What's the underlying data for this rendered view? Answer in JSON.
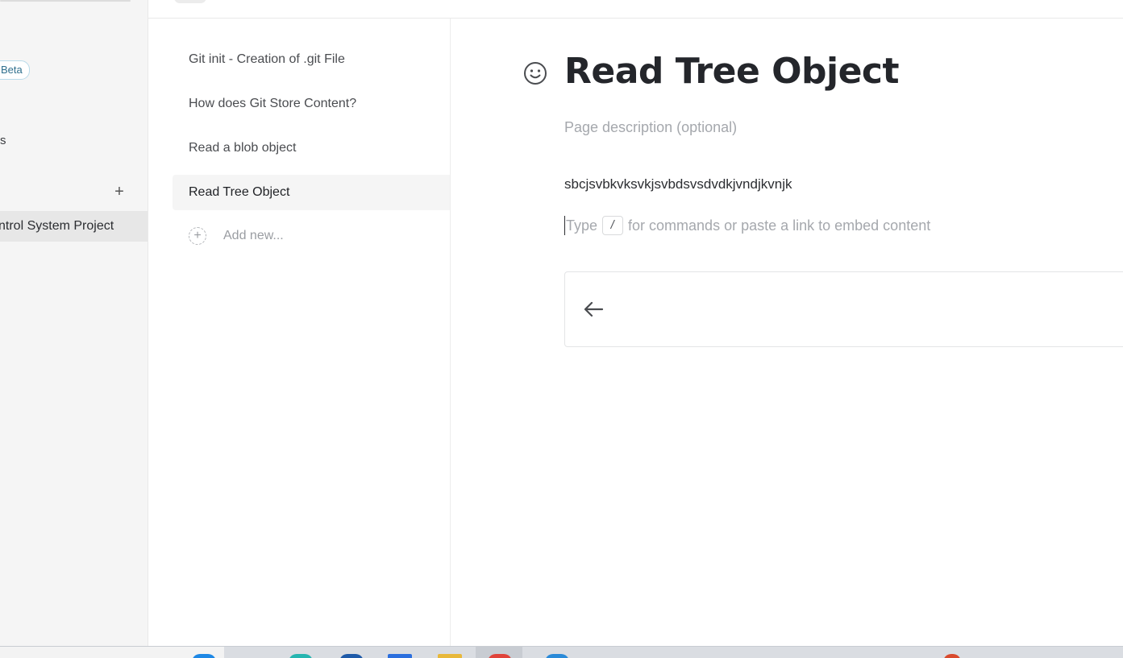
{
  "sidebar": {
    "beta_label": "Beta",
    "fragment_label": "s",
    "add_label": "+",
    "project_label": "ntrol System Project"
  },
  "pages": {
    "items": [
      {
        "label": "Git init - Creation of .git File",
        "active": false
      },
      {
        "label": "How does Git Store Content?",
        "active": false
      },
      {
        "label": "Read a blob object",
        "active": false
      },
      {
        "label": "Read Tree Object",
        "active": true
      }
    ],
    "add_new_label": "Add new..."
  },
  "editor": {
    "title": "Read Tree Object",
    "description_placeholder": "Page description (optional)",
    "body_text": "sbcjsvbkvksvkjsvbdsvsdvdkjvndjkvnjk",
    "command_prefix": "Type",
    "command_key": "/",
    "command_suffix": "for commands or paste a link to embed content"
  },
  "colors": {
    "sidebar_bg": "#f5f5f5",
    "active_item_bg": "#f5f5f5",
    "beta_border": "#b9dbea",
    "placeholder": "#a5a8ad",
    "title": "#24262b"
  },
  "icons": {
    "emoji": "smiley-face-icon",
    "nav_card": "arrow-left-icon",
    "add_new": "plus-circle-icon"
  }
}
